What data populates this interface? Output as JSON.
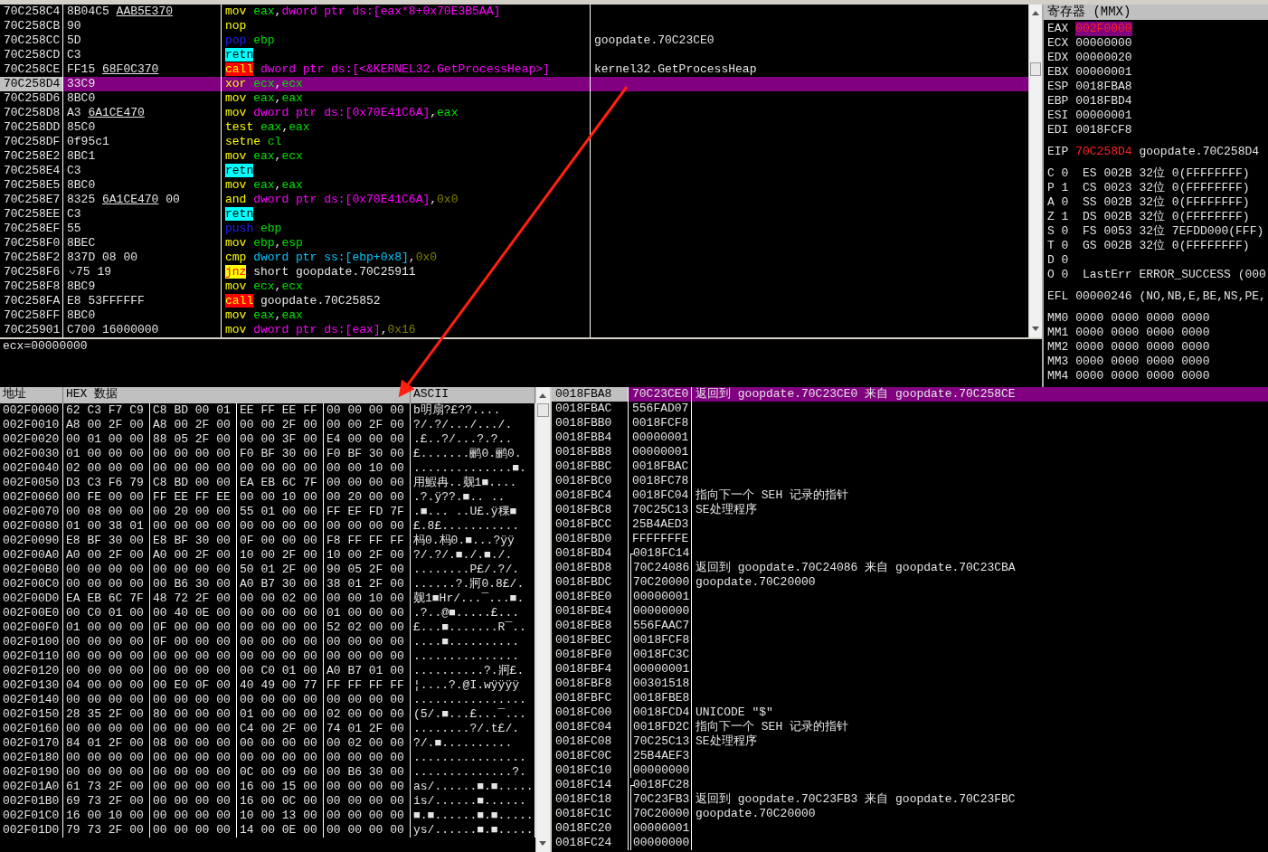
{
  "disassembly": {
    "rows": [
      {
        "address": "70C258C4",
        "bytes": "8B04C5",
        "fixup": "AAB5E370",
        "selected": false,
        "mnemonic": "mov",
        "kind": "plain",
        "operands": [
          {
            "text": "eax",
            "kind": "reg"
          },
          {
            "text": ",",
            "kind": "text"
          },
          {
            "text": "dword ptr ds:[eax*8+0x70E3B5AA]",
            "kind": "mem"
          }
        ]
      },
      {
        "address": "70C258CB",
        "bytes": "90",
        "selected": false,
        "mnemonic": "nop",
        "kind": "plain",
        "operands": []
      },
      {
        "address": "70C258CC",
        "bytes": "5D",
        "selected": false,
        "mnemonic": "pop",
        "kind": "stack",
        "operands": [
          {
            "text": "ebp",
            "kind": "reg"
          }
        ],
        "comment": "goopdate.70C23CE0"
      },
      {
        "address": "70C258CD",
        "bytes": "C3",
        "selected": false,
        "mnemonic": "retn",
        "kind": "ret",
        "operands": []
      },
      {
        "address": "70C258CE",
        "bytes": "FF15",
        "fixup": "68F0C370",
        "selected": false,
        "mnemonic": "call",
        "kind": "call",
        "operands": [
          {
            "text": "dword ptr ds:[<&KERNEL32.GetProcessHeap>]",
            "kind": "mem"
          }
        ],
        "comment": "kernel32.GetProcessHeap"
      },
      {
        "address": "70C258D4",
        "bytes": "33C9",
        "selected": true,
        "mnemonic": "xor",
        "kind": "plain",
        "operands": [
          {
            "text": "ecx",
            "kind": "reg"
          },
          {
            "text": ",",
            "kind": "text"
          },
          {
            "text": "ecx",
            "kind": "reg"
          }
        ]
      },
      {
        "address": "70C258D6",
        "bytes": "8BC0",
        "selected": false,
        "mnemonic": "mov",
        "kind": "plain",
        "operands": [
          {
            "text": "eax",
            "kind": "reg"
          },
          {
            "text": ",",
            "kind": "text"
          },
          {
            "text": "eax",
            "kind": "reg"
          }
        ]
      },
      {
        "address": "70C258D8",
        "bytes": "A3",
        "fixup": "6A1CE470",
        "selected": false,
        "mnemonic": "mov",
        "kind": "plain",
        "operands": [
          {
            "text": "dword ptr ds:[0x70E41C6A]",
            "kind": "mem"
          },
          {
            "text": ",",
            "kind": "text"
          },
          {
            "text": "eax",
            "kind": "reg"
          }
        ]
      },
      {
        "address": "70C258DD",
        "bytes": "85C0",
        "selected": false,
        "mnemonic": "test",
        "kind": "plain",
        "operands": [
          {
            "text": "eax",
            "kind": "reg"
          },
          {
            "text": ",",
            "kind": "text"
          },
          {
            "text": "eax",
            "kind": "reg"
          }
        ]
      },
      {
        "address": "70C258DF",
        "bytes": "0f95c1",
        "selected": false,
        "mnemonic": "setne",
        "kind": "plain",
        "operands": [
          {
            "text": "cl",
            "kind": "reg"
          }
        ]
      },
      {
        "address": "70C258E2",
        "bytes": "8BC1",
        "selected": false,
        "mnemonic": "mov",
        "kind": "plain",
        "operands": [
          {
            "text": "eax",
            "kind": "reg"
          },
          {
            "text": ",",
            "kind": "text"
          },
          {
            "text": "ecx",
            "kind": "reg"
          }
        ]
      },
      {
        "address": "70C258E4",
        "bytes": "C3",
        "selected": false,
        "mnemonic": "retn",
        "kind": "ret",
        "operands": []
      },
      {
        "address": "70C258E5",
        "bytes": "8BC0",
        "selected": false,
        "mnemonic": "mov",
        "kind": "plain",
        "operands": [
          {
            "text": "eax",
            "kind": "reg"
          },
          {
            "text": ",",
            "kind": "text"
          },
          {
            "text": "eax",
            "kind": "reg"
          }
        ]
      },
      {
        "address": "70C258E7",
        "bytes": "8325",
        "fixup": "6A1CE470",
        "tail": "00",
        "selected": false,
        "mnemonic": "and",
        "kind": "plain",
        "operands": [
          {
            "text": "dword ptr ds:[0x70E41C6A]",
            "kind": "mem"
          },
          {
            "text": ",",
            "kind": "text"
          },
          {
            "text": "0x0",
            "kind": "imm"
          }
        ]
      },
      {
        "address": "70C258EE",
        "bytes": "C3",
        "selected": false,
        "mnemonic": "retn",
        "kind": "ret",
        "operands": []
      },
      {
        "address": "70C258EF",
        "bytes": "55",
        "selected": false,
        "mnemonic": "push",
        "kind": "stack",
        "operands": [
          {
            "text": "ebp",
            "kind": "reg"
          }
        ]
      },
      {
        "address": "70C258F0",
        "bytes": "8BEC",
        "selected": false,
        "mnemonic": "mov",
        "kind": "plain",
        "operands": [
          {
            "text": "ebp",
            "kind": "reg"
          },
          {
            "text": ",",
            "kind": "text"
          },
          {
            "text": "esp",
            "kind": "reg"
          }
        ]
      },
      {
        "address": "70C258F2",
        "bytes": "837D 08 00",
        "selected": false,
        "mnemonic": "cmp",
        "kind": "plain",
        "operands": [
          {
            "text": "dword ptr ss:[ebp+0x8]",
            "kind": "stackmem"
          },
          {
            "text": ",",
            "kind": "text"
          },
          {
            "text": "0x0",
            "kind": "imm"
          }
        ]
      },
      {
        "address": "70C258F6",
        "bytes": "75 19",
        "jump": true,
        "selected": false,
        "mnemonic": "jnz",
        "kind": "jump",
        "operands": [
          {
            "text": "short goopdate.70C25911",
            "kind": "text"
          }
        ]
      },
      {
        "address": "70C258F8",
        "bytes": "8BC9",
        "selected": false,
        "mnemonic": "mov",
        "kind": "plain",
        "operands": [
          {
            "text": "ecx",
            "kind": "reg"
          },
          {
            "text": ",",
            "kind": "text"
          },
          {
            "text": "ecx",
            "kind": "reg"
          }
        ]
      },
      {
        "address": "70C258FA",
        "bytes": "E8 53FFFFFF",
        "selected": false,
        "mnemonic": "call",
        "kind": "call",
        "operands": [
          {
            "text": "goopdate.70C25852",
            "kind": "text"
          }
        ]
      },
      {
        "address": "70C258FF",
        "bytes": "8BC0",
        "selected": false,
        "mnemonic": "mov",
        "kind": "plain",
        "operands": [
          {
            "text": "eax",
            "kind": "reg"
          },
          {
            "text": ",",
            "kind": "text"
          },
          {
            "text": "eax",
            "kind": "reg"
          }
        ]
      },
      {
        "address": "70C25901",
        "bytes": "C700 16000000",
        "selected": false,
        "mnemonic": "mov",
        "kind": "plain",
        "operands": [
          {
            "text": "dword ptr ds:[eax]",
            "kind": "mem"
          },
          {
            "text": ",",
            "kind": "text"
          },
          {
            "text": "0x16",
            "kind": "imm"
          }
        ]
      }
    ],
    "info": "ecx=00000000"
  },
  "registers": {
    "title": "寄存器 (MMX)",
    "general": [
      {
        "name": "EAX",
        "value": "002F0000",
        "changed": true,
        "selected": true
      },
      {
        "name": "ECX",
        "value": "00000000",
        "changed": false,
        "selected": false
      },
      {
        "name": "EDX",
        "value": "00000020",
        "changed": false,
        "selected": false
      },
      {
        "name": "EBX",
        "value": "00000001",
        "changed": false,
        "selected": false
      },
      {
        "name": "ESP",
        "value": "0018FBA8",
        "changed": false,
        "selected": false
      },
      {
        "name": "EBP",
        "value": "0018FBD4",
        "changed": false,
        "selected": false
      },
      {
        "name": "ESI",
        "value": "00000001",
        "changed": false,
        "selected": false
      },
      {
        "name": "EDI",
        "value": "0018FCF8",
        "changed": false,
        "selected": false
      }
    ],
    "eip": {
      "name": "EIP",
      "value": "70C258D4",
      "changed": true,
      "comment": "goopdate.70C258D4"
    },
    "flags": [
      {
        "flag": "C",
        "bit": "0",
        "segment": "ES",
        "selector": "002B",
        "width": "32位",
        "base": "0(FFFFFFFF)"
      },
      {
        "flag": "P",
        "bit": "1",
        "segment": "CS",
        "selector": "0023",
        "width": "32位",
        "base": "0(FFFFFFFF)"
      },
      {
        "flag": "A",
        "bit": "0",
        "segment": "SS",
        "selector": "002B",
        "width": "32位",
        "base": "0(FFFFFFFF)"
      },
      {
        "flag": "Z",
        "bit": "1",
        "segment": "DS",
        "selector": "002B",
        "width": "32位",
        "base": "0(FFFFFFFF)"
      },
      {
        "flag": "S",
        "bit": "0",
        "segment": "FS",
        "selector": "0053",
        "width": "32位",
        "base": "7EFDD000(FFF)"
      },
      {
        "flag": "T",
        "bit": "0",
        "segment": "GS",
        "selector": "002B",
        "width": "32位",
        "base": "0(FFFFFFFF)"
      },
      {
        "flag": "D",
        "bit": "0"
      },
      {
        "flag": "O",
        "bit": "0",
        "last_error_label": "LastErr",
        "last_error": "ERROR_SUCCESS (000"
      }
    ],
    "efl": {
      "name": "EFL",
      "value": "00000246",
      "decoded": "(NO,NB,E,BE,NS,PE,"
    },
    "mmx": [
      {
        "name": "MM0",
        "value": "0000 0000 0000 0000"
      },
      {
        "name": "MM1",
        "value": "0000 0000 0000 0000"
      },
      {
        "name": "MM2",
        "value": "0000 0000 0000 0000"
      },
      {
        "name": "MM3",
        "value": "0000 0000 0000 0000"
      },
      {
        "name": "MM4",
        "value": "0000 0000 0000 0000"
      }
    ]
  },
  "dump": {
    "columns": [
      "地址",
      "HEX 数据",
      "ASCII"
    ],
    "rows": [
      {
        "address": "002F0000",
        "bytes": "62 C3 F7 C9 C8 BD 00 01 EE FF EE FF 00 00 00 00",
        "ascii": "b明扇?£??...."
      },
      {
        "address": "002F0010",
        "bytes": "A8 00 2F 00 A8 00 2F 00 00 00 2F 00 00 00 2F 00",
        "ascii": "?/.?/.../.../."
      },
      {
        "address": "002F0020",
        "bytes": "00 01 00 00 88 05 2F 00 00 00 3F 00 E4 00 00 00",
        "ascii": ".£..?/...?.?.."
      },
      {
        "address": "002F0030",
        "bytes": "01 00 00 00 00 00 00 00 F0 BF 30 00 F0 BF 30 00",
        "ascii": "£.......鹂0.鹂0."
      },
      {
        "address": "002F0040",
        "bytes": "02 00 00 00 00 00 00 00 00 00 00 00 00 00 10 00",
        "ascii": "..............■."
      },
      {
        "address": "002F0050",
        "bytes": "D3 C3 F6 79 C8 BD 00 00 EA EB 6C 7F 00 00 00 00",
        "ascii": "用鰕冉..觌1■...."
      },
      {
        "address": "002F0060",
        "bytes": "00 FE 00 00 FF EE FF EE 00 00 10 00 00 20 00 00",
        "ascii": ".?.ÿ??.■.. .."
      },
      {
        "address": "002F0070",
        "bytes": "00 08 00 00 00 20 00 00 55 01 00 00 FF EF FD 7F",
        "ascii": ".■... ..U£.ÿ稞■"
      },
      {
        "address": "002F0080",
        "bytes": "01 00 38 01 00 00 00 00 00 00 00 00 00 00 00 00",
        "ascii": "£.8£..........."
      },
      {
        "address": "002F0090",
        "bytes": "E8 BF 30 00 E8 BF 30 00 0F 00 00 00 F8 FF FF FF",
        "ascii": "杩0.杩0.■...?ÿÿ"
      },
      {
        "address": "002F00A0",
        "bytes": "A0 00 2F 00 A0 00 2F 00 10 00 2F 00 10 00 2F 00",
        "ascii": "?/.?/.■./.■./."
      },
      {
        "address": "002F00B0",
        "bytes": "00 00 00 00 00 00 00 00 50 01 2F 00 90 05 2F 00",
        "ascii": "........P£/.?/."
      },
      {
        "address": "002F00C0",
        "bytes": "00 00 00 00 00 B6 30 00 A0 B7 30 00 38 01 2F 00",
        "ascii": "......?.牁0.8£/."
      },
      {
        "address": "002F00D0",
        "bytes": "EA EB 6C 7F 48 72 2F 00 00 00 02 00 00 00 10 00",
        "ascii": "觌1■Hr/...¯...■."
      },
      {
        "address": "002F00E0",
        "bytes": "00 C0 01 00 00 40 0E 00 00 00 00 00 01 00 00 00",
        "ascii": ".?..@■.....£..."
      },
      {
        "address": "002F00F0",
        "bytes": "01 00 00 00 0F 00 00 00 00 00 00 00 52 02 00 00",
        "ascii": "£...■.......R¯.."
      },
      {
        "address": "002F0100",
        "bytes": "00 00 00 00 0F 00 00 00 00 00 00 00 00 00 00 00",
        "ascii": "....■.........."
      },
      {
        "address": "002F0110",
        "bytes": "00 00 00 00 00 00 00 00 00 00 00 00 00 00 00 00",
        "ascii": "..............."
      },
      {
        "address": "002F0120",
        "bytes": "00 00 00 00 00 00 00 00 00 C0 01 00 A0 B7 01 00",
        "ascii": "..........?.牁£."
      },
      {
        "address": "002F0130",
        "bytes": "04 00 00 00 00 E0 0F 00 40 49 00 77 FF FF FF FF",
        "ascii": "¦....?.@I.wÿÿÿÿ"
      },
      {
        "address": "002F0140",
        "bytes": "00 00 00 00 00 00 00 00 00 00 00 00 00 00 00 00",
        "ascii": "................"
      },
      {
        "address": "002F0150",
        "bytes": "28 35 2F 00 80 00 00 00 01 00 00 00 02 00 00 00",
        "ascii": "(5/.■...£...¯..."
      },
      {
        "address": "002F0160",
        "bytes": "00 00 00 00 00 00 00 00 C4 00 2F 00 74 01 2F 00",
        "ascii": "........?/.t£/."
      },
      {
        "address": "002F0170",
        "bytes": "84 01 2F 00 08 00 00 00 00 00 00 00 00 02 00 00",
        "ascii": "?/.■.........."
      },
      {
        "address": "002F0180",
        "bytes": "00 00 00 00 00 00 00 00 00 00 00 00 00 00 00 00",
        "ascii": "................"
      },
      {
        "address": "002F0190",
        "bytes": "00 00 00 00 00 00 00 00 0C 00 09 00 00 B6 30 00",
        "ascii": "..............?."
      },
      {
        "address": "002F01A0",
        "bytes": "61 73 2F 00 00 00 00 00 16 00 15 00 00 00 00 00",
        "ascii": "as/......■.■....."
      },
      {
        "address": "002F01B0",
        "bytes": "69 73 2F 00 00 00 00 00 16 00 0C 00 00 00 00 00",
        "ascii": "is/......■......"
      },
      {
        "address": "002F01C0",
        "bytes": "16 00 10 00 00 00 00 00 10 00 13 00 00 00 00 00",
        "ascii": "■.■......■.■....."
      },
      {
        "address": "002F01D0",
        "bytes": "79 73 2F 00 00 00 00 00 14 00 0E 00 00 00 00 00",
        "ascii": "ys/......■.■....."
      }
    ]
  },
  "stack": {
    "rows": [
      {
        "address": "0018FBA8",
        "value": "70C23CE0",
        "comment": "返回到 goopdate.70C23CE0 来自 goopdate.70C258CE",
        "selected": true
      },
      {
        "address": "0018FBAC",
        "value": "556FAD07",
        "selected": false
      },
      {
        "address": "0018FBB0",
        "value": "0018FCF8",
        "selected": false
      },
      {
        "address": "0018FBB4",
        "value": "00000001",
        "selected": false
      },
      {
        "address": "0018FBB8",
        "value": "00000001",
        "selected": false
      },
      {
        "address": "0018FBBC",
        "value": "0018FBAC",
        "selected": false
      },
      {
        "address": "0018FBC0",
        "value": "0018FC78",
        "selected": false
      },
      {
        "address": "0018FBC4",
        "value": "0018FC04",
        "comment": "指向下一个 SEH 记录的指针",
        "selected": false
      },
      {
        "address": "0018FBC8",
        "value": "70C25C13",
        "comment": "SE处理程序",
        "selected": false
      },
      {
        "address": "0018FBCC",
        "value": "25B4AED3",
        "selected": false
      },
      {
        "address": "0018FBD0",
        "value": "FFFFFFFE",
        "selected": false
      },
      {
        "address": "0018FBD4",
        "value": "0018FC14",
        "selected": false,
        "chain_head": true
      },
      {
        "address": "0018FBD8",
        "value": "70C24086",
        "comment": "返回到 goopdate.70C24086 来自 goopdate.70C23CBA",
        "selected": false,
        "linked": true
      },
      {
        "address": "0018FBDC",
        "value": "70C20000",
        "comment": "goopdate.70C20000",
        "selected": false,
        "linked": true
      },
      {
        "address": "0018FBE0",
        "value": "00000001",
        "selected": false,
        "linked": true
      },
      {
        "address": "0018FBE4",
        "value": "00000000",
        "selected": false,
        "linked": true
      },
      {
        "address": "0018FBE8",
        "value": "556FAAC7",
        "selected": false,
        "linked": true
      },
      {
        "address": "0018FBEC",
        "value": "0018FCF8",
        "selected": false,
        "linked": true
      },
      {
        "address": "0018FBF0",
        "value": "0018FC3C",
        "selected": false,
        "linked": true
      },
      {
        "address": "0018FBF4",
        "value": "00000001",
        "selected": false,
        "linked": true
      },
      {
        "address": "0018FBF8",
        "value": "00301518",
        "selected": false,
        "linked": true
      },
      {
        "address": "0018FBFC",
        "value": "0018FBE8",
        "selected": false,
        "linked": true
      },
      {
        "address": "0018FC00",
        "value": "0018FCD4",
        "comment": "UNICODE \"$\"",
        "selected": false,
        "linked": true
      },
      {
        "address": "0018FC04",
        "value": "0018FD2C",
        "comment": "指向下一个 SEH 记录的指针",
        "selected": false,
        "linked": true
      },
      {
        "address": "0018FC08",
        "value": "70C25C13",
        "comment": "SE处理程序",
        "selected": false,
        "linked": true
      },
      {
        "address": "0018FC0C",
        "value": "25B4AEF3",
        "selected": false,
        "linked": true
      },
      {
        "address": "0018FC10",
        "value": "00000000",
        "selected": false,
        "linked": true
      },
      {
        "address": "0018FC14",
        "value": "0018FC28",
        "selected": false,
        "chain_head": true
      },
      {
        "address": "0018FC18",
        "value": "70C23FB3",
        "comment": "返回到 goopdate.70C23FB3 来自 goopdate.70C23FBC",
        "selected": false,
        "linked": true
      },
      {
        "address": "0018FC1C",
        "value": "70C20000",
        "comment": "goopdate.70C20000",
        "selected": false,
        "linked": true
      },
      {
        "address": "0018FC20",
        "value": "00000001",
        "selected": false,
        "linked": true
      },
      {
        "address": "0018FC24",
        "value": "00000000",
        "selected": false,
        "linked": true
      }
    ]
  }
}
